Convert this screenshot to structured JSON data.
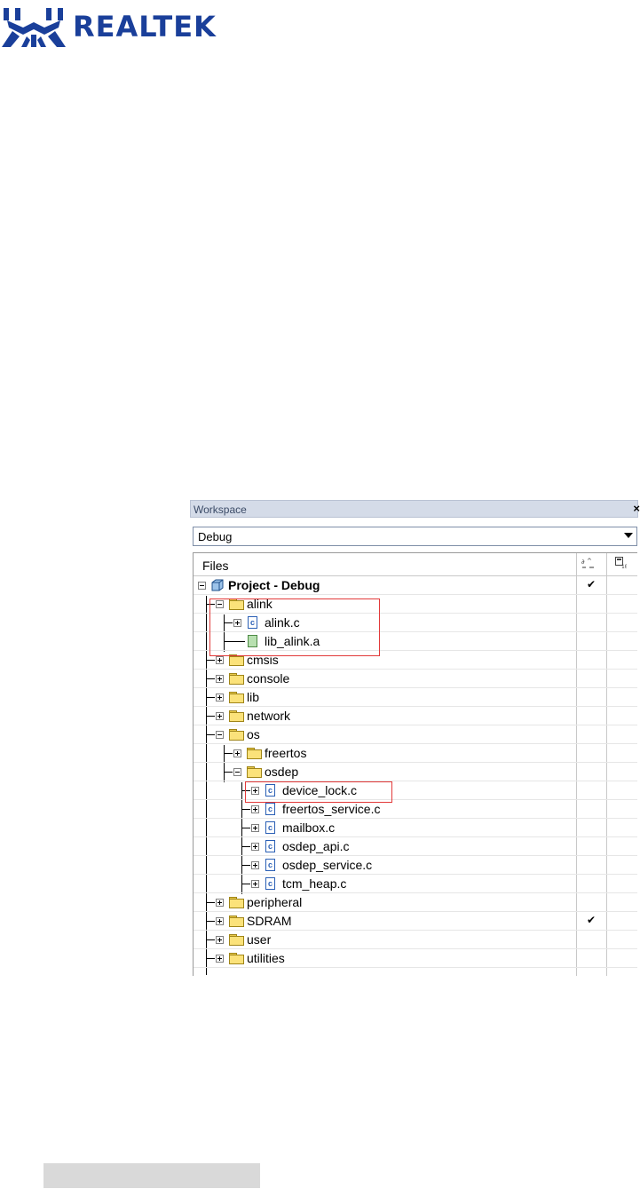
{
  "logo": {
    "text": "Realtek",
    "icon": "realtek-crab-logo"
  },
  "workspace": {
    "title": "Workspace",
    "close_icon": "×",
    "config": "Debug",
    "files_header": "Files",
    "check_mark": "✔",
    "tree": [
      {
        "label": "Project - Debug",
        "bold": true,
        "checked": true,
        "icon": "project-icon"
      },
      {
        "label": "alink",
        "icon": "folder-icon"
      },
      {
        "label": "alink.c",
        "icon": "c-file-icon"
      },
      {
        "label": "lib_alink.a",
        "icon": "library-file-icon"
      },
      {
        "label": "cmsis",
        "icon": "folder-icon"
      },
      {
        "label": "console",
        "icon": "folder-icon"
      },
      {
        "label": "lib",
        "icon": "folder-icon"
      },
      {
        "label": "network",
        "icon": "folder-icon"
      },
      {
        "label": "os",
        "icon": "folder-icon"
      },
      {
        "label": "freertos",
        "icon": "folder-icon"
      },
      {
        "label": "osdep",
        "icon": "folder-icon"
      },
      {
        "label": "device_lock.c",
        "icon": "c-file-icon"
      },
      {
        "label": "freertos_service.c",
        "icon": "c-file-icon"
      },
      {
        "label": "mailbox.c",
        "icon": "c-file-icon"
      },
      {
        "label": "osdep_api.c",
        "icon": "c-file-icon"
      },
      {
        "label": "osdep_service.c",
        "icon": "c-file-icon"
      },
      {
        "label": "tcm_heap.c",
        "icon": "c-file-icon"
      },
      {
        "label": "peripheral",
        "icon": "folder-icon"
      },
      {
        "label": "SDRAM",
        "checked": true,
        "icon": "folder-icon"
      },
      {
        "label": "user",
        "icon": "folder-icon"
      },
      {
        "label": "utilities",
        "icon": "folder-icon"
      }
    ]
  }
}
